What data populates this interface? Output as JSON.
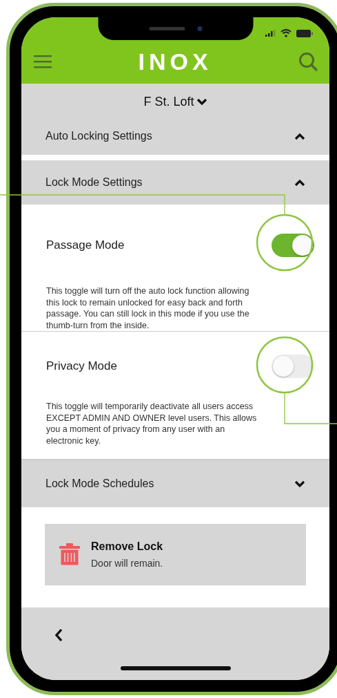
{
  "header": {
    "logo": "INOX"
  },
  "location": {
    "name": "F St. Loft"
  },
  "sections": [
    {
      "title": "Auto Locking Settings",
      "expanded": true
    },
    {
      "title": "Lock Mode Settings",
      "expanded": true,
      "settings": [
        {
          "label": "Passage Mode",
          "on": true,
          "description": "This toggle will turn off the auto lock function allowing this lock to remain unlocked for easy back and forth passage. You can still lock in this mode if you use the thumb-turn from the inside."
        },
        {
          "label": "Privacy Mode",
          "on": false,
          "description": "This toggle will temporarily deactivate all users access EXCEPT ADMIN AND OWNER level users. This allows you a moment of privacy from any user with an electronic key."
        }
      ]
    },
    {
      "title": "Lock Mode Schedules",
      "expanded": false
    }
  ],
  "action_card": {
    "title": "Remove Lock",
    "subtitle": "Door will remain."
  }
}
